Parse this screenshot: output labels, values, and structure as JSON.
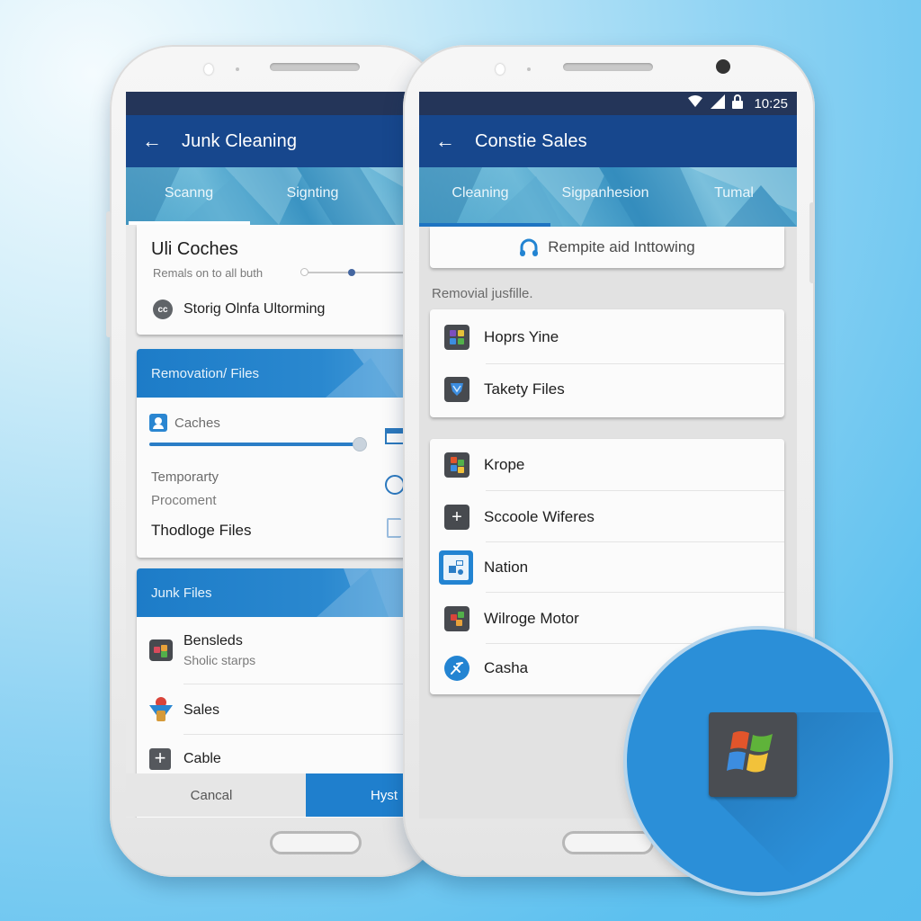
{
  "left_phone": {
    "status_icons": [
      "wifi-icon"
    ],
    "app_title": "Junk Cleaning",
    "tabs": [
      {
        "label": "Scanng",
        "active": true
      },
      {
        "label": "Signting",
        "active": false
      }
    ],
    "summary_card": {
      "title": "Uli Coches",
      "subtitle": "Remals on to all buth",
      "slider_steps": 3,
      "slider_active_step": 2,
      "row_label": "Storig Olnfa Ultorming"
    },
    "removation_card": {
      "header": "Removation/ Files",
      "caches_label": "Caches",
      "caches_progress_percent": 96,
      "items": [
        "Temporarty",
        "Procoment"
      ],
      "footer_label": "Thodloge Files"
    },
    "junk_card": {
      "header": "Junk Files",
      "items": [
        {
          "title": "Bensleds",
          "subtitle": "Sholic starps",
          "icon": "app-grid-icon"
        },
        {
          "title": "Sales",
          "subtitle": "",
          "icon": "person-badge-icon"
        },
        {
          "title": "Cable",
          "subtitle": "",
          "icon": "plus-icon"
        }
      ]
    },
    "buttons": {
      "cancel": "Cancal",
      "primary": "Hyst"
    }
  },
  "right_phone": {
    "status_time": "10:25",
    "status_icons": [
      "wifi-icon",
      "signal-icon",
      "lock-icon"
    ],
    "app_title": "Constie Sales",
    "tabs": [
      {
        "label": "Cleaning",
        "active": true
      },
      {
        "label": "Sigpanhesion",
        "active": false
      },
      {
        "label": "Tumal",
        "active": false
      }
    ],
    "action_button": "Rempite aid Inttowing",
    "section_label": "Removial jusfille.",
    "group1": [
      {
        "label": "Hoprs Yine",
        "icon": "app-grid-icon"
      },
      {
        "label": "Takety Files",
        "icon": "shield-app-icon"
      }
    ],
    "group2": [
      {
        "label": "Krope",
        "icon": "app-grid-icon"
      },
      {
        "label": "Sccoole Wiferes",
        "icon": "plus-icon"
      },
      {
        "label": "Nation",
        "icon": "diagram-icon"
      },
      {
        "label": "Wilroge Motor",
        "icon": "app-grid-icon"
      },
      {
        "label": "Casha",
        "icon": "compass-icon"
      }
    ]
  },
  "badge": {
    "icon": "windows-logo-icon",
    "colors": {
      "circle": "#2b8fd8",
      "tile": "#4a4d52",
      "red": "#e2552b",
      "green": "#5fb33a",
      "blue": "#3c8de0",
      "yellow": "#f2c23a"
    }
  },
  "colors": {
    "status_bar": "#243559",
    "app_bar": "#17478d",
    "accent": "#1d7cc8"
  }
}
